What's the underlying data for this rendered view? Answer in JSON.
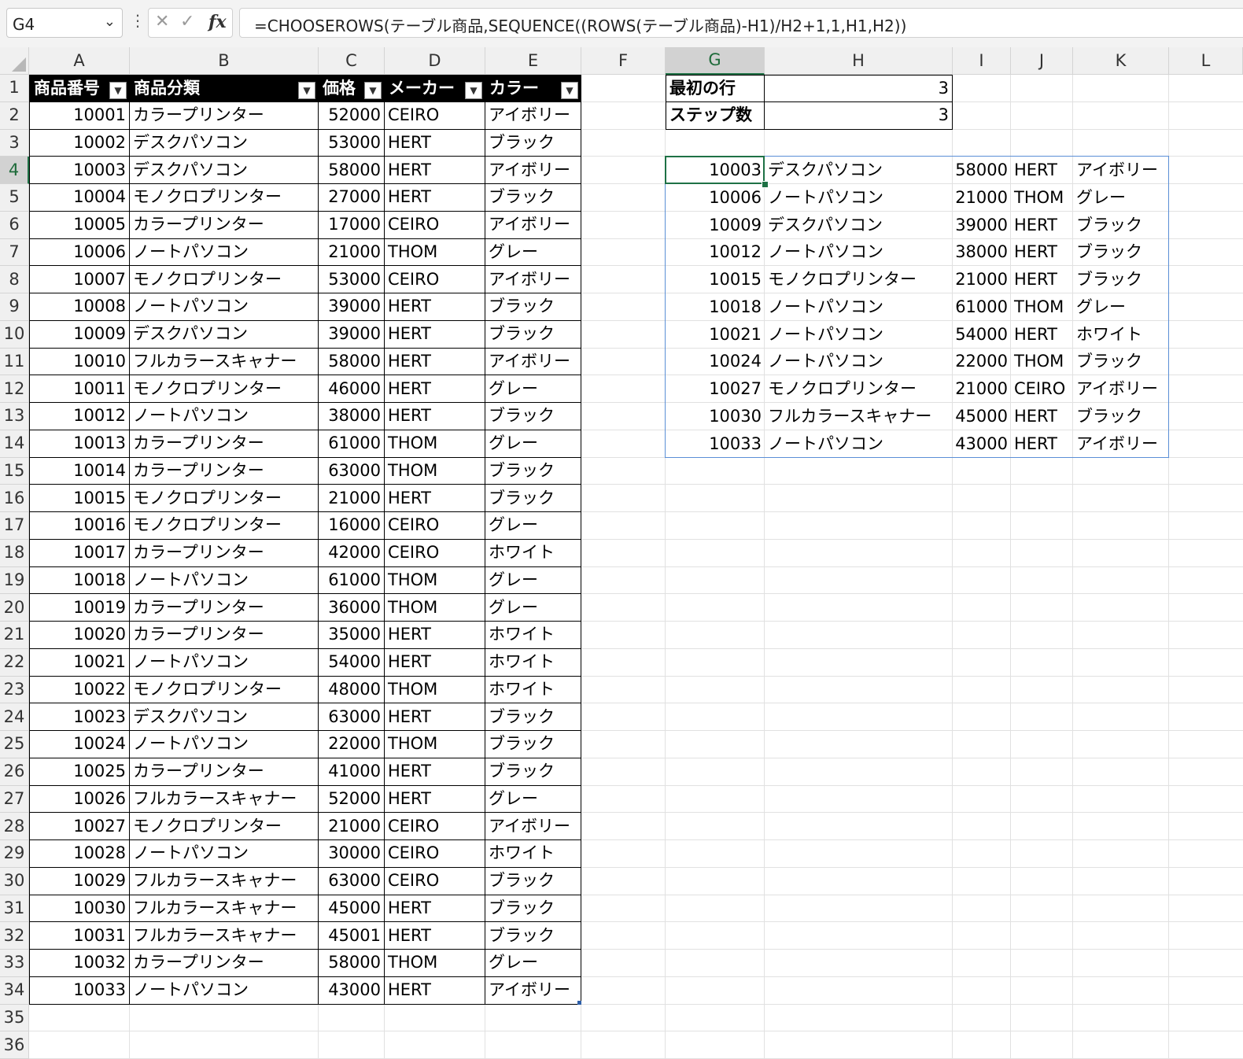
{
  "formula_bar": {
    "name_box": "G4",
    "dots": "⋮",
    "cancel_icon": "✕",
    "enter_icon": "✓",
    "fx_label": "fx",
    "formula": "=CHOOSEROWS(テーブル商品,SEQUENCE((ROWS(テーブル商品)-H1)/H2+1,1,H1,H2))"
  },
  "columns": [
    "A",
    "B",
    "C",
    "D",
    "E",
    "F",
    "G",
    "H",
    "I",
    "J",
    "K",
    "L"
  ],
  "row_numbers": [
    "1",
    "2",
    "3",
    "4",
    "5",
    "6",
    "7",
    "8",
    "9",
    "10",
    "11",
    "12",
    "13",
    "14",
    "15",
    "16",
    "17",
    "18",
    "19",
    "20",
    "21",
    "22",
    "23",
    "24",
    "25",
    "26",
    "27",
    "28",
    "29",
    "30",
    "31",
    "32",
    "33",
    "34",
    "35",
    "36"
  ],
  "selected_column": "G",
  "selected_row": "4",
  "table": {
    "headers": [
      "商品番号",
      "商品分類",
      "価格",
      "メーカー",
      "カラー"
    ],
    "rows": [
      [
        "10001",
        "カラープリンター",
        "52000",
        "CEIRO",
        "アイボリー"
      ],
      [
        "10002",
        "デスクパソコン",
        "53000",
        "HERT",
        "ブラック"
      ],
      [
        "10003",
        "デスクパソコン",
        "58000",
        "HERT",
        "アイボリー"
      ],
      [
        "10004",
        "モノクロプリンター",
        "27000",
        "HERT",
        "ブラック"
      ],
      [
        "10005",
        "カラープリンター",
        "17000",
        "CEIRO",
        "アイボリー"
      ],
      [
        "10006",
        "ノートパソコン",
        "21000",
        "THOM",
        "グレー"
      ],
      [
        "10007",
        "モノクロプリンター",
        "53000",
        "CEIRO",
        "アイボリー"
      ],
      [
        "10008",
        "ノートパソコン",
        "39000",
        "HERT",
        "ブラック"
      ],
      [
        "10009",
        "デスクパソコン",
        "39000",
        "HERT",
        "ブラック"
      ],
      [
        "10010",
        "フルカラースキャナー",
        "58000",
        "HERT",
        "アイボリー"
      ],
      [
        "10011",
        "モノクロプリンター",
        "46000",
        "HERT",
        "グレー"
      ],
      [
        "10012",
        "ノートパソコン",
        "38000",
        "HERT",
        "ブラック"
      ],
      [
        "10013",
        "カラープリンター",
        "61000",
        "THOM",
        "グレー"
      ],
      [
        "10014",
        "カラープリンター",
        "63000",
        "THOM",
        "ブラック"
      ],
      [
        "10015",
        "モノクロプリンター",
        "21000",
        "HERT",
        "ブラック"
      ],
      [
        "10016",
        "モノクロプリンター",
        "16000",
        "CEIRO",
        "グレー"
      ],
      [
        "10017",
        "カラープリンター",
        "42000",
        "CEIRO",
        "ホワイト"
      ],
      [
        "10018",
        "ノートパソコン",
        "61000",
        "THOM",
        "グレー"
      ],
      [
        "10019",
        "カラープリンター",
        "36000",
        "THOM",
        "グレー"
      ],
      [
        "10020",
        "カラープリンター",
        "35000",
        "HERT",
        "ホワイト"
      ],
      [
        "10021",
        "ノートパソコン",
        "54000",
        "HERT",
        "ホワイト"
      ],
      [
        "10022",
        "モノクロプリンター",
        "48000",
        "THOM",
        "ホワイト"
      ],
      [
        "10023",
        "デスクパソコン",
        "63000",
        "HERT",
        "ブラック"
      ],
      [
        "10024",
        "ノートパソコン",
        "22000",
        "THOM",
        "ブラック"
      ],
      [
        "10025",
        "カラープリンター",
        "41000",
        "HERT",
        "ブラック"
      ],
      [
        "10026",
        "フルカラースキャナー",
        "52000",
        "HERT",
        "グレー"
      ],
      [
        "10027",
        "モノクロプリンター",
        "21000",
        "CEIRO",
        "アイボリー"
      ],
      [
        "10028",
        "ノートパソコン",
        "30000",
        "CEIRO",
        "ホワイト"
      ],
      [
        "10029",
        "フルカラースキャナー",
        "63000",
        "CEIRO",
        "ブラック"
      ],
      [
        "10030",
        "フルカラースキャナー",
        "45000",
        "HERT",
        "ブラック"
      ],
      [
        "10031",
        "フルカラースキャナー",
        "45001",
        "HERT",
        "ブラック"
      ],
      [
        "10032",
        "カラープリンター",
        "58000",
        "THOM",
        "グレー"
      ],
      [
        "10033",
        "ノートパソコン",
        "43000",
        "HERT",
        "アイボリー"
      ]
    ]
  },
  "params": {
    "first_row_label": "最初の行",
    "first_row_value": "3",
    "step_label": "ステップ数",
    "step_value": "3"
  },
  "result": [
    [
      "10003",
      "デスクパソコン",
      "58000",
      "HERT",
      "アイボリー"
    ],
    [
      "10006",
      "ノートパソコン",
      "21000",
      "THOM",
      "グレー"
    ],
    [
      "10009",
      "デスクパソコン",
      "39000",
      "HERT",
      "ブラック"
    ],
    [
      "10012",
      "ノートパソコン",
      "38000",
      "HERT",
      "ブラック"
    ],
    [
      "10015",
      "モノクロプリンター",
      "21000",
      "HERT",
      "ブラック"
    ],
    [
      "10018",
      "ノートパソコン",
      "61000",
      "THOM",
      "グレー"
    ],
    [
      "10021",
      "ノートパソコン",
      "54000",
      "HERT",
      "ホワイト"
    ],
    [
      "10024",
      "ノートパソコン",
      "22000",
      "THOM",
      "ブラック"
    ],
    [
      "10027",
      "モノクロプリンター",
      "21000",
      "CEIRO",
      "アイボリー"
    ],
    [
      "10030",
      "フルカラースキャナー",
      "45000",
      "HERT",
      "ブラック"
    ],
    [
      "10033",
      "ノートパソコン",
      "43000",
      "HERT",
      "アイボリー"
    ]
  ]
}
